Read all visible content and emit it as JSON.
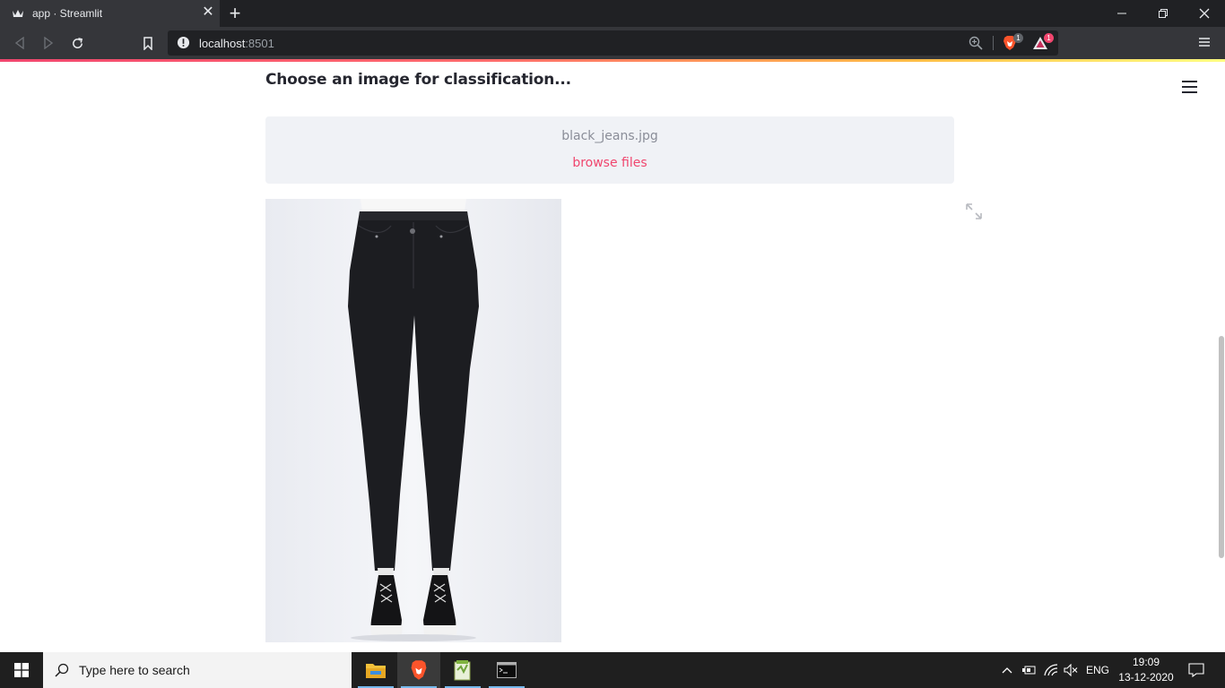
{
  "browser": {
    "tab_title": "app · Streamlit",
    "url_host": "localhost",
    "url_port": ":8501",
    "shields_count": "1",
    "rewards_count": "1"
  },
  "app": {
    "heading": "Choose an image for classification...",
    "uploader": {
      "file_name": "black_jeans.jpg",
      "browse_label": "browse files"
    },
    "image_alt": "black jeans product photo",
    "colors": {
      "accent": "#f0466e",
      "text": "#262730",
      "uploader_bg": "#f0f2f6"
    }
  },
  "taskbar": {
    "search_placeholder": "Type here to search",
    "language": "ENG",
    "time": "19:09",
    "date": "13-12-2020"
  }
}
